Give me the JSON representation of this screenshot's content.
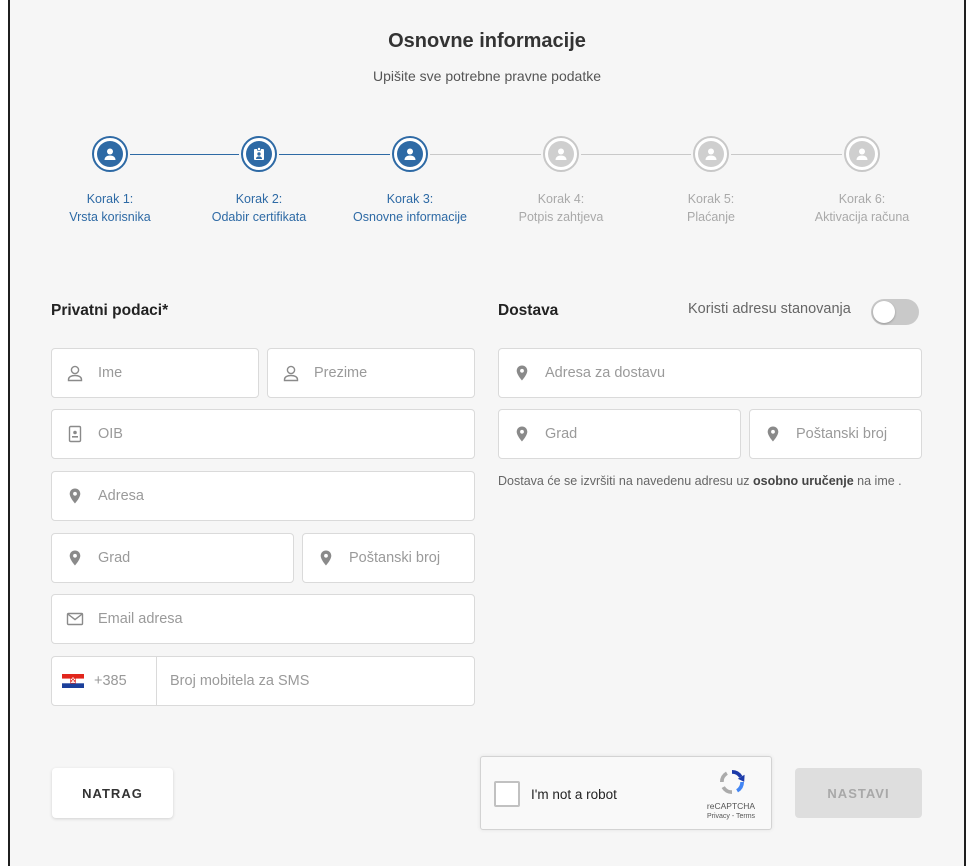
{
  "header": {
    "title": "Osnovne informacije",
    "subtitle": "Upišite sve potrebne pravne podatke"
  },
  "steps": [
    {
      "label": "Korak 1:",
      "name": "Vrsta korisnika",
      "state": "completed",
      "icon": "user-icon"
    },
    {
      "label": "Korak 2:",
      "name": "Odabir certifikata",
      "state": "completed",
      "icon": "id-card-icon"
    },
    {
      "label": "Korak 3:",
      "name": "Osnovne informacije",
      "state": "active",
      "icon": "user-icon"
    },
    {
      "label": "Korak 4:",
      "name": "Potpis zahtjeva",
      "state": "inactive",
      "icon": "user-icon"
    },
    {
      "label": "Korak 5:",
      "name": "Plaćanje",
      "state": "inactive",
      "icon": "user-icon"
    },
    {
      "label": "Korak 6:",
      "name": "Aktivacija računa",
      "state": "inactive",
      "icon": "user-icon"
    }
  ],
  "private": {
    "title": "Privatni podaci*",
    "first_name_placeholder": "Ime",
    "last_name_placeholder": "Prezime",
    "oib_placeholder": "OIB",
    "address_placeholder": "Adresa",
    "city_placeholder": "Grad",
    "postal_placeholder": "Poštanski broj",
    "email_placeholder": "Email adresa",
    "phone_code": "+385",
    "phone_placeholder": "Broj mobitela za SMS"
  },
  "delivery": {
    "title": "Dostava",
    "toggle_label": "Koristi adresu stanovanja",
    "toggle_on": false,
    "address_placeholder": "Adresa za dostavu",
    "city_placeholder": "Grad",
    "postal_placeholder": "Poštanski broj",
    "note_before": "Dostava će se izvršiti na navedenu adresu uz ",
    "note_bold": "osobno uručenje",
    "note_after": " na ime ."
  },
  "actions": {
    "back_label": "NATRAG",
    "next_label": "NASTAVI"
  },
  "captcha": {
    "label": "I'm not a robot",
    "brand": "reCAPTCHA",
    "links": "Privacy - Terms"
  },
  "colors": {
    "accent": "#2e6aa5",
    "inactive": "#c8c8c8",
    "background": "#f6f6f6"
  }
}
